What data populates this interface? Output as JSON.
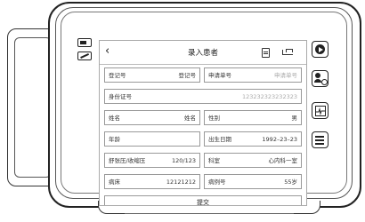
{
  "header": {
    "title": "录入患者"
  },
  "form": {
    "reg_no": {
      "label": "登记号",
      "value": "登记号"
    },
    "request_no": {
      "label": "申请单号",
      "placeholder": "申请单号"
    },
    "id_card": {
      "label": "身份证号",
      "value": "123232323232323"
    },
    "name": {
      "label": "姓名",
      "value": "姓名"
    },
    "gender": {
      "label": "性别",
      "value": "男"
    },
    "age": {
      "label": "年龄",
      "value": ""
    },
    "birth_date": {
      "label": "出生日期",
      "value": "1992–23–23"
    },
    "blood_pressure": {
      "label": "舒张压/收缩压",
      "value": "120/123"
    },
    "department": {
      "label": "科室",
      "value": "心内科一室"
    },
    "bed": {
      "label": "病床",
      "value": "12121212"
    },
    "case_no": {
      "label": "病例号",
      "value": "55岁"
    }
  },
  "actions": {
    "submit_label": "提交"
  },
  "icons": {
    "back": "chevron-left-icon",
    "document": "document-icon",
    "bed": "bed-icon",
    "battery": "battery-icon",
    "no_signal": "no-signal-icon",
    "play": "play-icon",
    "patient": "patient-icon",
    "ecg": "ecg-icon",
    "menu": "list-icon"
  }
}
